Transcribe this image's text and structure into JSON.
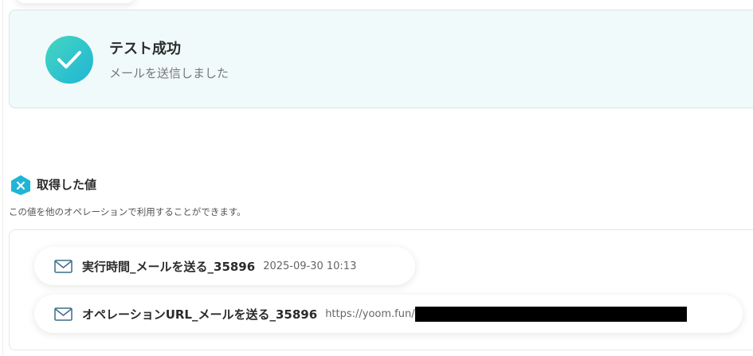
{
  "success": {
    "title": "テスト成功",
    "subtitle": "メールを送信しました",
    "icon": "check-icon",
    "accent_start": "#45d6c0",
    "accent_end": "#1fb5d6"
  },
  "section": {
    "title": "取得した値",
    "description": "この値を他のオペレーションで利用することができます。",
    "icon": "variable-icon",
    "icon_color": "#1fb5d6"
  },
  "values": [
    {
      "label": "実行時間_メールを送る_35896",
      "value": "2025-09-30 10:13",
      "icon": "mail-icon"
    },
    {
      "label": "オペレーションURL_メールを送る_35896",
      "value": "https://yoom.fun/",
      "icon": "mail-icon",
      "redacted": true
    }
  ]
}
